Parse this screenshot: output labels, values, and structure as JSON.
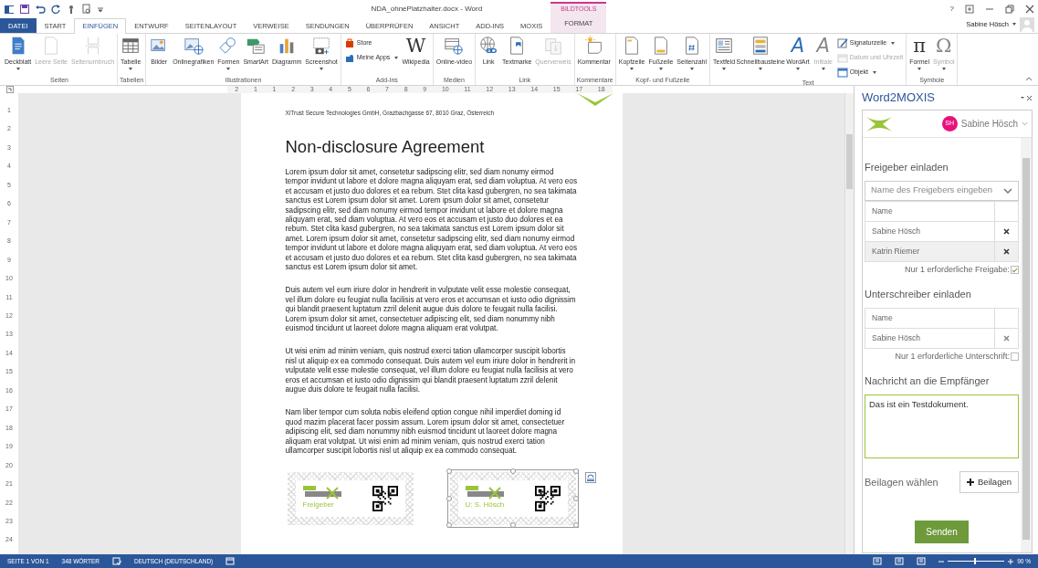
{
  "window": {
    "title": "NDA_ohnePlatzhalter.docx - Word",
    "user": "Sabine Hösch",
    "help": "?"
  },
  "tabs": [
    {
      "label": "DATEI",
      "kind": "file",
      "selected": false
    },
    {
      "label": "START",
      "kind": "normal",
      "selected": false
    },
    {
      "label": "EINFÜGEN",
      "kind": "normal",
      "selected": true
    },
    {
      "label": "ENTWURF",
      "kind": "normal",
      "selected": false
    },
    {
      "label": "SEITENLAYOUT",
      "kind": "normal",
      "selected": false
    },
    {
      "label": "VERWEISE",
      "kind": "normal",
      "selected": false
    },
    {
      "label": "SENDUNGEN",
      "kind": "normal",
      "selected": false
    },
    {
      "label": "ÜBERPRÜFEN",
      "kind": "normal",
      "selected": false
    },
    {
      "label": "ANSICHT",
      "kind": "normal",
      "selected": false
    },
    {
      "label": "ADD-INS",
      "kind": "normal",
      "selected": false
    },
    {
      "label": "MOXIS",
      "kind": "normal",
      "selected": false
    },
    {
      "label": "FORMAT",
      "kind": "contextual",
      "context": "BILDTOOLS",
      "selected": false
    }
  ],
  "ribbon": {
    "groups": [
      {
        "label": "Seiten",
        "buttons": [
          {
            "label": "Deckblatt",
            "kind": "large",
            "dropdown": true,
            "disabled": false
          },
          {
            "label": "Leere Seite",
            "kind": "large",
            "dropdown": false,
            "disabled": true
          },
          {
            "label": "Seitenumbruch",
            "kind": "large",
            "dropdown": false,
            "disabled": true
          }
        ]
      },
      {
        "label": "Tabellen",
        "buttons": [
          {
            "label": "Tabelle",
            "kind": "large",
            "dropdown": true,
            "disabled": false
          }
        ]
      },
      {
        "label": "Illustrationen",
        "buttons": [
          {
            "label": "Bilder",
            "kind": "large",
            "dropdown": false,
            "disabled": false
          },
          {
            "label": "Onlinegrafiken",
            "kind": "large",
            "dropdown": false,
            "disabled": false
          },
          {
            "label": "Formen",
            "kind": "large",
            "dropdown": true,
            "disabled": false
          },
          {
            "label": "SmartArt",
            "kind": "large",
            "dropdown": false,
            "disabled": false
          },
          {
            "label": "Diagramm",
            "kind": "large",
            "dropdown": false,
            "disabled": false
          },
          {
            "label": "Screenshot",
            "kind": "large",
            "dropdown": true,
            "disabled": false
          }
        ]
      },
      {
        "label": "Add-Ins",
        "buttons": [
          {
            "label": "Store",
            "kind": "small",
            "dropdown": false,
            "disabled": false
          },
          {
            "label": "Meine Apps",
            "kind": "small",
            "dropdown": true,
            "disabled": false
          },
          {
            "label": "Wikipedia",
            "kind": "large",
            "dropdown": false,
            "disabled": false,
            "glyph": "W"
          }
        ]
      },
      {
        "label": "Medien",
        "buttons": [
          {
            "label": "Online-video",
            "kind": "large",
            "dropdown": false,
            "disabled": false
          }
        ]
      },
      {
        "label": "Link",
        "buttons": [
          {
            "label": "Link",
            "kind": "large",
            "dropdown": false,
            "disabled": false
          },
          {
            "label": "Textmarke",
            "kind": "large",
            "dropdown": false,
            "disabled": false
          },
          {
            "label": "Querverweis",
            "kind": "large",
            "dropdown": false,
            "disabled": true
          }
        ]
      },
      {
        "label": "Kommentare",
        "buttons": [
          {
            "label": "Kommentar",
            "kind": "large",
            "dropdown": false,
            "disabled": false
          }
        ]
      },
      {
        "label": "Kopf- und Fußzeile",
        "buttons": [
          {
            "label": "Kopfzeile",
            "kind": "large",
            "dropdown": true,
            "disabled": false
          },
          {
            "label": "Fußzeile",
            "kind": "large",
            "dropdown": true,
            "disabled": false
          },
          {
            "label": "Seitenzahl",
            "kind": "large",
            "dropdown": true,
            "disabled": false
          }
        ]
      },
      {
        "label": "Text",
        "buttons": [
          {
            "label": "Textfeld",
            "kind": "large",
            "dropdown": true,
            "disabled": false
          },
          {
            "label": "Schnellbausteine",
            "kind": "large",
            "dropdown": true,
            "disabled": false
          },
          {
            "label": "WordArt",
            "kind": "large",
            "dropdown": true,
            "disabled": false,
            "glyph": "A"
          },
          {
            "label": "Initiale",
            "kind": "large",
            "dropdown": true,
            "disabled": true,
            "glyph": "A"
          },
          {
            "label": "Signaturzeile",
            "kind": "small",
            "dropdown": true,
            "disabled": false
          },
          {
            "label": "Datum und Uhrzeit",
            "kind": "small",
            "dropdown": false,
            "disabled": true
          },
          {
            "label": "Objekt",
            "kind": "small",
            "dropdown": true,
            "disabled": false
          }
        ]
      },
      {
        "label": "Symbole",
        "buttons": [
          {
            "label": "Formel",
            "kind": "large",
            "dropdown": true,
            "disabled": false,
            "glyph": "π"
          },
          {
            "label": "Symbol",
            "kind": "large",
            "dropdown": true,
            "disabled": true,
            "glyph": "Ω"
          }
        ]
      }
    ]
  },
  "ruler": {
    "marks": [
      "2",
      "1",
      "1",
      "2",
      "3",
      "4",
      "5",
      "6",
      "7",
      "8",
      "9",
      "10",
      "11",
      "12",
      "13",
      "14",
      "15",
      "17",
      "18"
    ],
    "vertical_marks": [
      "1",
      "2",
      "3",
      "4",
      "5",
      "6",
      "7",
      "8",
      "9",
      "10",
      "11",
      "12",
      "13",
      "14",
      "15",
      "16",
      "17",
      "18",
      "19",
      "20",
      "21",
      "22",
      "23",
      "24"
    ]
  },
  "document": {
    "header": "XiTrust Secure Technologies GmbH, Grazbachgasse 67, 8010 Graz, Österreich",
    "title": "Non-disclosure Agreement",
    "paragraphs": [
      "Lorem ipsum dolor sit amet, consetetur sadipscing elitr, sed diam nonumy eirmod tempor invidunt ut labore et dolore magna aliquyam erat, sed diam voluptua. At vero eos et accusam et justo duo dolores et ea rebum. Stet clita kasd gubergren, no sea takimata sanctus est Lorem ipsum dolor sit amet. Lorem ipsum dolor sit amet, consetetur sadipscing elitr, sed diam nonumy eirmod tempor invidunt ut labore et dolore magna aliquyam erat, sed diam voluptua. At vero eos et accusam et justo duo dolores et ea rebum. Stet clita kasd gubergren, no sea takimata sanctus est Lorem ipsum dolor sit amet. Lorem ipsum dolor sit amet, consetetur sadipscing elitr, sed diam nonumy eirmod tempor invidunt ut labore et dolore magna aliquyam erat, sed diam voluptua. At vero eos et accusam et justo duo dolores et ea rebum. Stet clita kasd gubergren, no sea takimata sanctus est Lorem ipsum dolor sit amet.",
      "Duis autem vel eum iriure dolor in hendrerit in vulputate velit esse molestie consequat, vel illum dolore eu feugiat nulla facilisis at vero eros et accumsan et iusto odio dignissim qui blandit praesent luptatum zzril delenit augue duis dolore te feugait nulla facilisi. Lorem ipsum dolor sit amet, consectetuer adipiscing elit, sed diam nonummy nibh euismod tincidunt ut laoreet dolore magna aliquam erat volutpat.",
      "Ut wisi enim ad minim veniam, quis nostrud exerci tation ullamcorper suscipit lobortis nisl ut aliquip ex ea commodo consequat. Duis autem vel eum iriure dolor in hendrerit in vulputate velit esse molestie consequat, vel illum dolore eu feugiat nulla facilisis at vero eros et accumsan et iusto odio dignissim qui blandit praesent luptatum zzril delenit augue duis dolore te feugait nulla facilisi.",
      "Nam liber tempor cum soluta nobis eleifend option congue nihil imperdiet doming id quod mazim placerat facer possim assum. Lorem ipsum dolor sit amet, consectetuer adipiscing elit, sed diam nonummy nibh euismod tincidunt ut laoreet dolore magna aliquam erat volutpat. Ut wisi enim ad minim veniam, quis nostrud exerci tation ullamcorper suscipit lobortis nisl ut aliquip ex ea commodo consequat."
    ],
    "signature_fields": [
      {
        "label": "Freigeber",
        "selected": false
      },
      {
        "label": "U: S. Hösch",
        "selected": true
      }
    ]
  },
  "pane": {
    "title": "Word2MOXIS",
    "user": "Sabine Hösch",
    "initials": "SH",
    "approvers": {
      "heading": "Freigeber einladen",
      "placeholder": "Name des Freigebers eingeben",
      "column": "Name",
      "rows": [
        {
          "name": "Sabine Hösch",
          "selected": false
        },
        {
          "name": "Katrin Riemer",
          "selected": true
        }
      ],
      "option": {
        "label": "Nur 1 erforderliche Freigabe:",
        "checked": true
      }
    },
    "signers": {
      "heading": "Unterschreiber einladen",
      "column": "Name",
      "rows": [
        {
          "name": "Sabine Hösch",
          "selected": false
        }
      ],
      "option": {
        "label": "Nur 1 erforderliche Unterschrift:",
        "checked": false
      }
    },
    "message": {
      "heading": "Nachricht an die Empfänger",
      "value": "Das ist ein Testdokument."
    },
    "attachments": {
      "label": "Beilagen wählen",
      "button": "Beilagen"
    },
    "submit": "Senden"
  },
  "status_bar": {
    "page": "SEITE 1 VON 1",
    "words": "348 WÖRTER",
    "language": "DEUTSCH (DEUTSCHLAND)",
    "zoom": "90 %",
    "level": 0.46
  }
}
